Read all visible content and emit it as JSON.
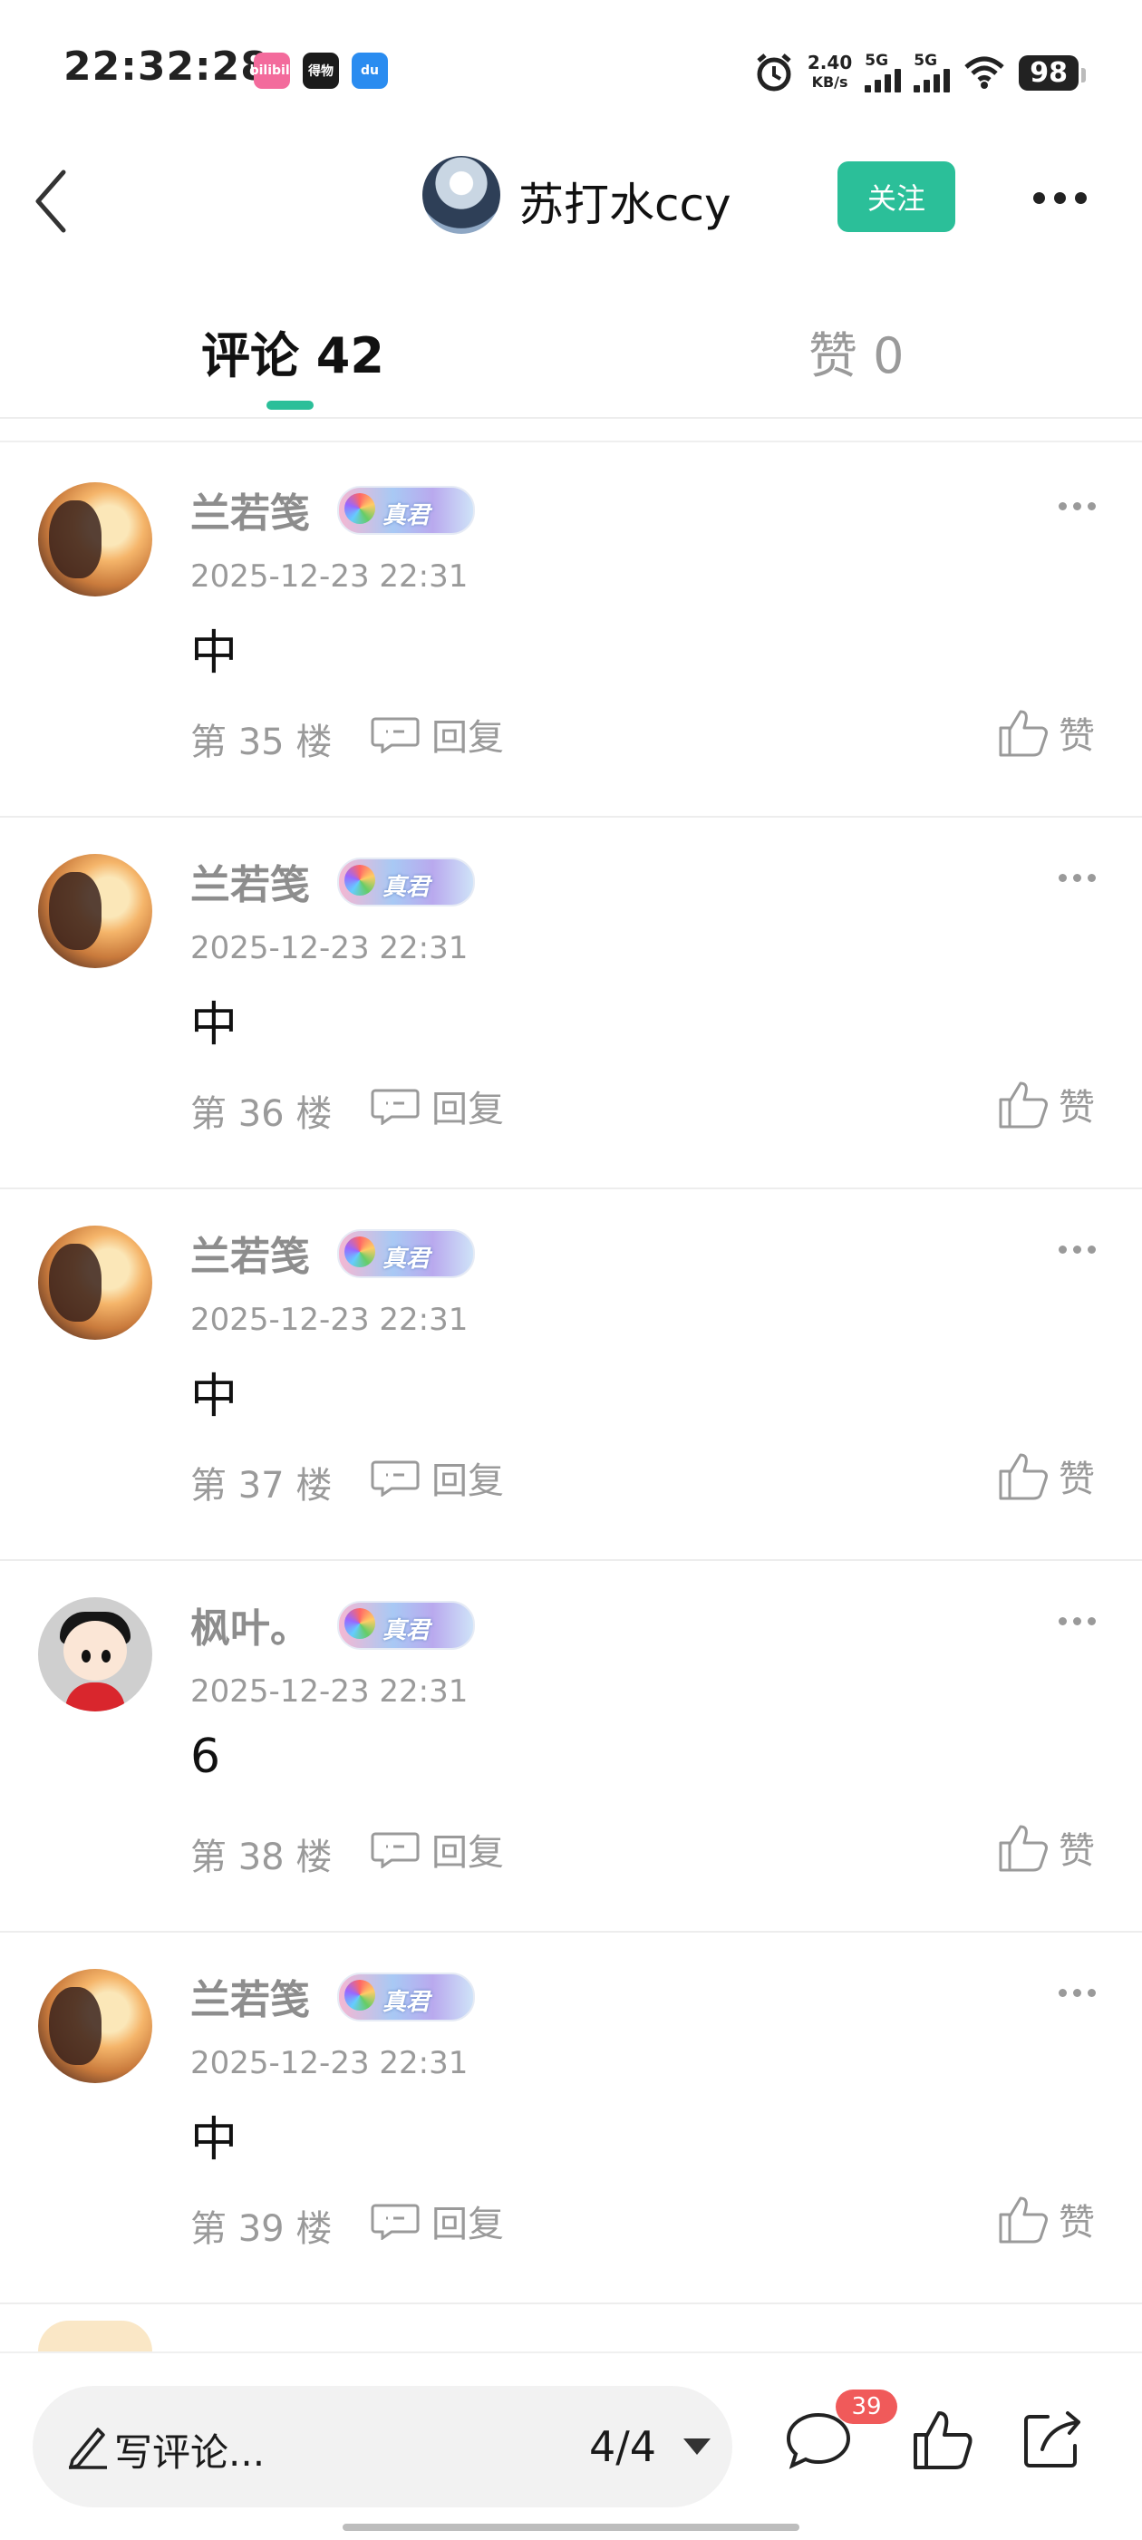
{
  "status_bar": {
    "time": "22:32:28",
    "apps": [
      "bilibili",
      "得物",
      "du"
    ],
    "net_speed_value": "2.40",
    "net_speed_unit": "KB/s",
    "signal1_label": "5G",
    "signal2_label": "5G",
    "battery": "98"
  },
  "header": {
    "username": "苏打水ccy",
    "follow_label": "关注"
  },
  "tabs": {
    "comments_label": "评论 42",
    "likes_label": "赞 0"
  },
  "comments": [
    {
      "name": "兰若笺",
      "badge": "真君",
      "time": "2025-12-23 22:31",
      "text": "中",
      "floor": "第 35 楼",
      "reply": "回复",
      "like": "赞"
    },
    {
      "name": "兰若笺",
      "badge": "真君",
      "time": "2025-12-23 22:31",
      "text": "中",
      "floor": "第 36 楼",
      "reply": "回复",
      "like": "赞"
    },
    {
      "name": "兰若笺",
      "badge": "真君",
      "time": "2025-12-23 22:31",
      "text": "中",
      "floor": "第 37 楼",
      "reply": "回复",
      "like": "赞"
    },
    {
      "name": "枫叶。",
      "badge": "真君",
      "time": "2025-12-23 22:31",
      "text": "6",
      "floor": "第 38 楼",
      "reply": "回复",
      "like": "赞"
    },
    {
      "name": "兰若笺",
      "badge": "真君",
      "time": "2025-12-23 22:31",
      "text": "中",
      "floor": "第 39 楼",
      "reply": "回复",
      "like": "赞"
    }
  ],
  "bottom_bar": {
    "write_placeholder": "写评论...",
    "page_indicator": "4/4",
    "comment_count": "39"
  },
  "colors": {
    "accent": "#2bbf99",
    "badge_red": "#f05a5a",
    "muted_text": "#9a9a9a"
  }
}
